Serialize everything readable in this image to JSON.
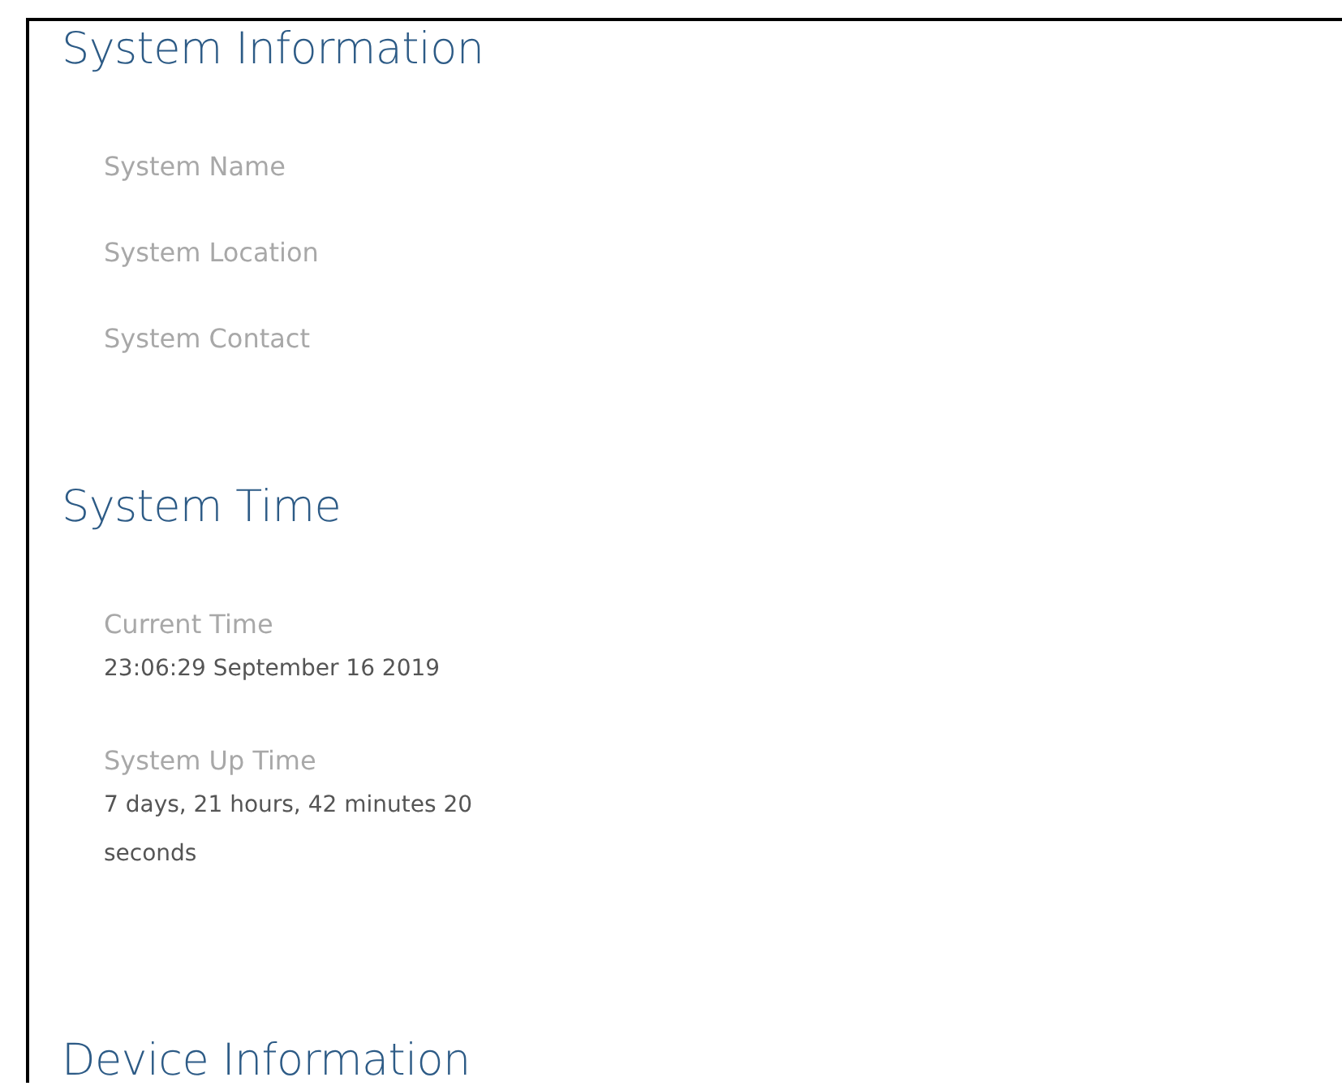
{
  "sections": [
    {
      "title": "System Information",
      "fields": [
        {
          "label": "System Name"
        },
        {
          "label": "System Location"
        },
        {
          "label": "System Contact"
        }
      ]
    },
    {
      "title": "System Time",
      "fields": [
        {
          "label": "Current Time",
          "value": "23:06:29 September 16 2019"
        },
        {
          "label": "System Up Time",
          "value": "7 days, 21 hours, 42 minutes 20 seconds"
        }
      ]
    },
    {
      "title": "Device Information"
    }
  ]
}
